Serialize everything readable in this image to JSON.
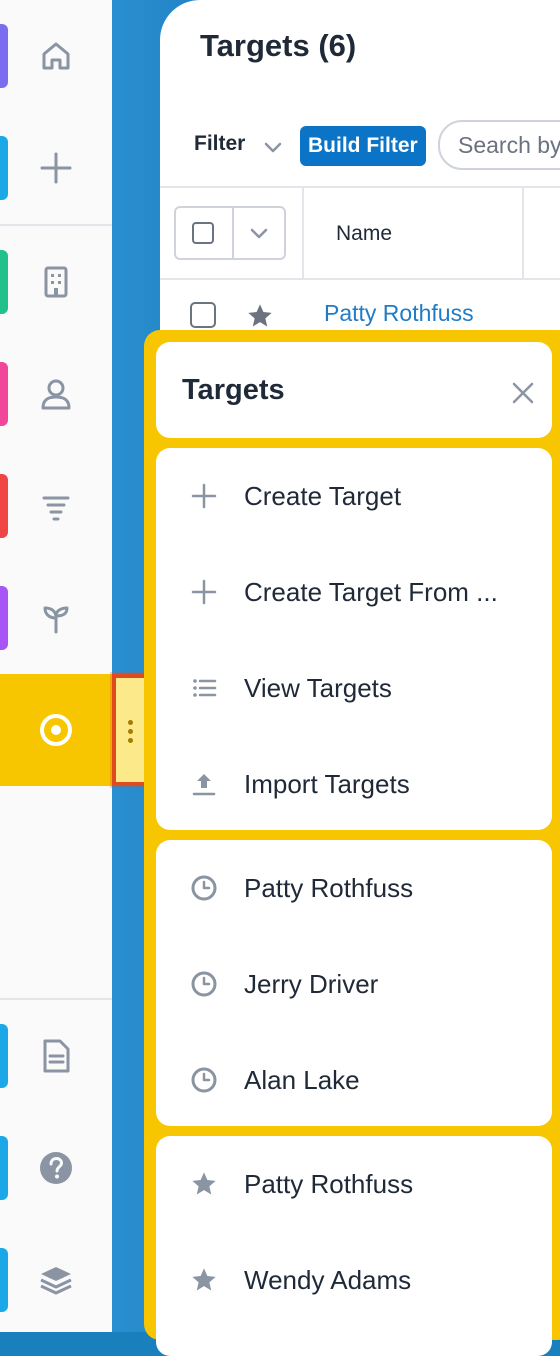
{
  "sidebar": {
    "items": [
      {
        "name": "home-icon",
        "color": "#7c6cf0"
      },
      {
        "name": "plus-icon",
        "color": "#1aa9e6"
      },
      {
        "name": "building-icon",
        "color": "#22c08a"
      },
      {
        "name": "contact-icon",
        "color": "#f0479a"
      },
      {
        "name": "funnel-icon",
        "color": "#f04545"
      },
      {
        "name": "sprout-icon",
        "color": "#a855f7"
      },
      {
        "name": "target-icon",
        "color": "#f7c600",
        "active": true
      },
      {
        "name": "document-icon",
        "color": "#1aa9e6"
      },
      {
        "name": "help-icon",
        "color": "#1aa9e6"
      },
      {
        "name": "layers-icon",
        "color": "#1aa9e6"
      }
    ]
  },
  "main": {
    "title": "Targets",
    "count": "(6)",
    "filter_label": "Filter",
    "build_filter_label": "Build Filter",
    "search_placeholder": "Search by",
    "column_name": "Name",
    "rows": [
      {
        "name": "Patty Rothfuss",
        "starred": true
      }
    ]
  },
  "menu": {
    "title": "Targets",
    "actions": [
      {
        "label": "Create Target",
        "icon": "plus-icon"
      },
      {
        "label": "Create Target From ...",
        "icon": "plus-icon"
      },
      {
        "label": "View Targets",
        "icon": "list-icon"
      },
      {
        "label": "Import Targets",
        "icon": "upload-icon"
      }
    ],
    "recent": [
      {
        "label": "Patty Rothfuss",
        "icon": "clock-icon"
      },
      {
        "label": "Jerry Driver",
        "icon": "clock-icon"
      },
      {
        "label": "Alan Lake",
        "icon": "clock-icon"
      }
    ],
    "favorites": [
      {
        "label": "Patty Rothfuss",
        "icon": "star-icon"
      },
      {
        "label": "Wendy Adams",
        "icon": "star-icon"
      }
    ]
  },
  "colors": {
    "accent": "#f7c600",
    "brand_blue": "#1877b8",
    "link": "#1f7cc7",
    "highlight_border": "#e04a1f"
  }
}
